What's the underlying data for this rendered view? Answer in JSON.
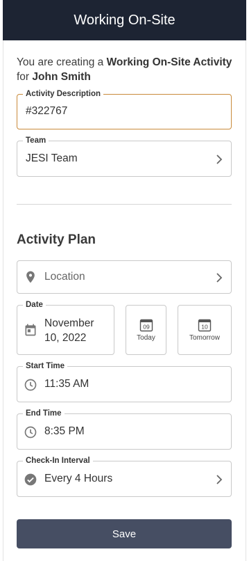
{
  "header": {
    "title": "Working On-Site"
  },
  "intro": {
    "prefix": "You are creating a ",
    "activity": "Working On-Site Activity",
    "for_word": "for ",
    "person": "John Smith"
  },
  "form": {
    "description": {
      "label": "Activity Description",
      "value": "#322767"
    },
    "team": {
      "label": "Team",
      "value": "JESI Team"
    },
    "section_title": "Activity Plan",
    "location": {
      "placeholder": "Location"
    },
    "date": {
      "label": "Date",
      "value": "November 10, 2022"
    },
    "today": {
      "day": "09",
      "label": "Today"
    },
    "tomorrow": {
      "day": "10",
      "label": "Tomorrow"
    },
    "start_time": {
      "label": "Start Time",
      "value": "11:35 AM"
    },
    "end_time": {
      "label": "End Time",
      "value": "8:35 PM"
    },
    "checkin": {
      "label": "Check-In Interval",
      "value": "Every 4 Hours"
    }
  },
  "actions": {
    "save_label": "Save"
  },
  "colors": {
    "header_bg": "#1d2433",
    "focus_border": "#c98a3a",
    "save_bg": "#464e63",
    "icon": "#777777"
  }
}
